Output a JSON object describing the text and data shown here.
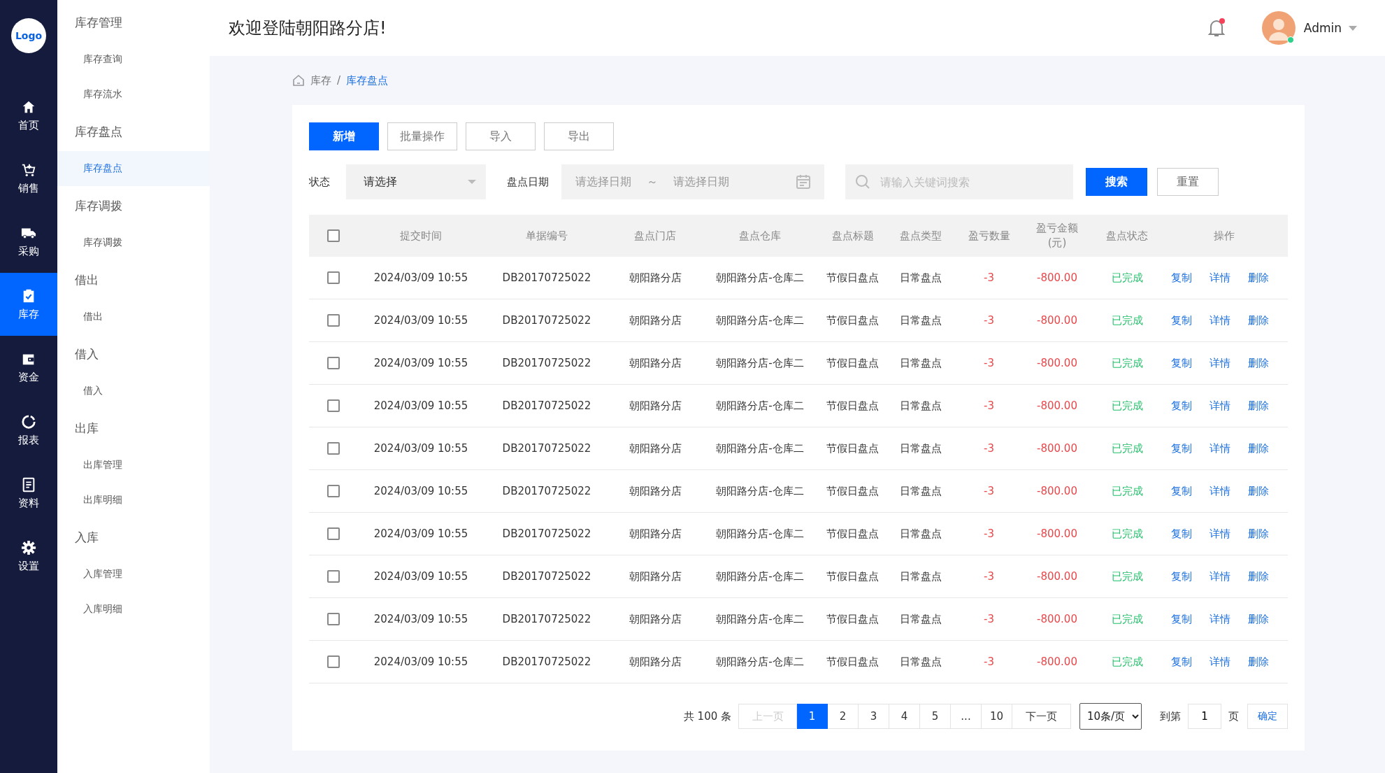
{
  "rail": {
    "logo": "Logo",
    "items": [
      {
        "label": "首页",
        "selected": false
      },
      {
        "label": "销售",
        "selected": false
      },
      {
        "label": "采购",
        "selected": false
      },
      {
        "label": "库存",
        "selected": true
      },
      {
        "label": "资金",
        "selected": false
      },
      {
        "label": "报表",
        "selected": false
      },
      {
        "label": "资料",
        "selected": false
      },
      {
        "label": "设置",
        "selected": false
      }
    ]
  },
  "submenu": [
    {
      "label": "库存管理",
      "children": [
        {
          "label": "库存查询",
          "selected": false
        },
        {
          "label": "库存流水",
          "selected": false
        }
      ]
    },
    {
      "label": "库存盘点",
      "children": [
        {
          "label": "库存盘点",
          "selected": true
        }
      ]
    },
    {
      "label": "库存调拨",
      "children": [
        {
          "label": "库存调拨",
          "selected": false
        }
      ]
    },
    {
      "label": "借出",
      "children": [
        {
          "label": "借出",
          "selected": false
        }
      ]
    },
    {
      "label": "借入",
      "children": [
        {
          "label": "借入",
          "selected": false
        }
      ]
    },
    {
      "label": "出库",
      "children": [
        {
          "label": "出库管理",
          "selected": false
        },
        {
          "label": "出库明细",
          "selected": false
        }
      ]
    },
    {
      "label": "入库",
      "children": [
        {
          "label": "入库管理",
          "selected": false
        },
        {
          "label": "入库明细",
          "selected": false
        }
      ]
    }
  ],
  "header": {
    "title": "欢迎登陆朝阳路分店!",
    "unread": true,
    "user": {
      "name": "Admin",
      "online": true
    }
  },
  "breadcrumb_separator": "/",
  "breadcrumb": [
    {
      "label": "库存",
      "selected": false
    },
    {
      "label": "库存盘点",
      "selected": true
    }
  ],
  "toolbar": [
    {
      "label": "新增",
      "kind": "primary"
    },
    {
      "label": "批量操作",
      "kind": "default"
    },
    {
      "label": "导入",
      "kind": "default"
    },
    {
      "label": "导出",
      "kind": "default"
    }
  ],
  "filters": {
    "status_label": "状态",
    "status_value": "请选择",
    "date_label": "盘点日期",
    "date_start_placeholder": "请选择日期",
    "date_separator": "～",
    "date_end_placeholder": "请选择日期",
    "keyword_placeholder": "请输入关键词搜索",
    "search_button": "搜索",
    "reset_button": "重置"
  },
  "table": {
    "all_checked": false,
    "columns": [
      "提交时间",
      "单据编号",
      "盘点门店",
      "盘点仓库",
      "盘点标题",
      "盘点类型",
      "盈亏数量",
      "盈亏金额\n(元)",
      "盘点状态",
      "操作"
    ],
    "rows": [
      {
        "checked": false,
        "cells": [
          "2024/03/09 10:55",
          "DB20170725022",
          "朝阳路分店",
          "朝阳路分店-仓库二",
          "节假日盘点",
          "日常盘点",
          "-3",
          "-800.00",
          "已完成"
        ],
        "actions": [
          "复制",
          "详情",
          "删除"
        ]
      },
      {
        "checked": false,
        "cells": [
          "2024/03/09 10:55",
          "DB20170725022",
          "朝阳路分店",
          "朝阳路分店-仓库二",
          "节假日盘点",
          "日常盘点",
          "-3",
          "-800.00",
          "已完成"
        ],
        "actions": [
          "复制",
          "详情",
          "删除"
        ]
      },
      {
        "checked": false,
        "cells": [
          "2024/03/09 10:55",
          "DB20170725022",
          "朝阳路分店",
          "朝阳路分店-仓库二",
          "节假日盘点",
          "日常盘点",
          "-3",
          "-800.00",
          "已完成"
        ],
        "actions": [
          "复制",
          "详情",
          "删除"
        ]
      },
      {
        "checked": false,
        "cells": [
          "2024/03/09 10:55",
          "DB20170725022",
          "朝阳路分店",
          "朝阳路分店-仓库二",
          "节假日盘点",
          "日常盘点",
          "-3",
          "-800.00",
          "已完成"
        ],
        "actions": [
          "复制",
          "详情",
          "删除"
        ]
      },
      {
        "checked": false,
        "cells": [
          "2024/03/09 10:55",
          "DB20170725022",
          "朝阳路分店",
          "朝阳路分店-仓库二",
          "节假日盘点",
          "日常盘点",
          "-3",
          "-800.00",
          "已完成"
        ],
        "actions": [
          "复制",
          "详情",
          "删除"
        ]
      },
      {
        "checked": false,
        "cells": [
          "2024/03/09 10:55",
          "DB20170725022",
          "朝阳路分店",
          "朝阳路分店-仓库二",
          "节假日盘点",
          "日常盘点",
          "-3",
          "-800.00",
          "已完成"
        ],
        "actions": [
          "复制",
          "详情",
          "删除"
        ]
      },
      {
        "checked": false,
        "cells": [
          "2024/03/09 10:55",
          "DB20170725022",
          "朝阳路分店",
          "朝阳路分店-仓库二",
          "节假日盘点",
          "日常盘点",
          "-3",
          "-800.00",
          "已完成"
        ],
        "actions": [
          "复制",
          "详情",
          "删除"
        ]
      },
      {
        "checked": false,
        "cells": [
          "2024/03/09 10:55",
          "DB20170725022",
          "朝阳路分店",
          "朝阳路分店-仓库二",
          "节假日盘点",
          "日常盘点",
          "-3",
          "-800.00",
          "已完成"
        ],
        "actions": [
          "复制",
          "详情",
          "删除"
        ]
      },
      {
        "checked": false,
        "cells": [
          "2024/03/09 10:55",
          "DB20170725022",
          "朝阳路分店",
          "朝阳路分店-仓库二",
          "节假日盘点",
          "日常盘点",
          "-3",
          "-800.00",
          "已完成"
        ],
        "actions": [
          "复制",
          "详情",
          "删除"
        ]
      },
      {
        "checked": false,
        "cells": [
          "2024/03/09 10:55",
          "DB20170725022",
          "朝阳路分店",
          "朝阳路分店-仓库二",
          "节假日盘点",
          "日常盘点",
          "-3",
          "-800.00",
          "已完成"
        ],
        "actions": [
          "复制",
          "详情",
          "删除"
        ]
      }
    ]
  },
  "pagination": {
    "total": "共 100 条",
    "prev": {
      "label": "上一页",
      "disabled": true
    },
    "pages": [
      {
        "label": "1",
        "selected": true
      },
      {
        "label": "2",
        "selected": false
      },
      {
        "label": "3",
        "selected": false
      },
      {
        "label": "4",
        "selected": false
      },
      {
        "label": "5",
        "selected": false
      },
      {
        "label": "...",
        "selected": false
      },
      {
        "label": "10",
        "selected": false
      }
    ],
    "next": {
      "label": "下一页",
      "disabled": false
    },
    "page_size": "10条/页",
    "goto_label": "到第",
    "goto_value": "1",
    "goto_unit": "页",
    "confirm": "确定"
  }
}
